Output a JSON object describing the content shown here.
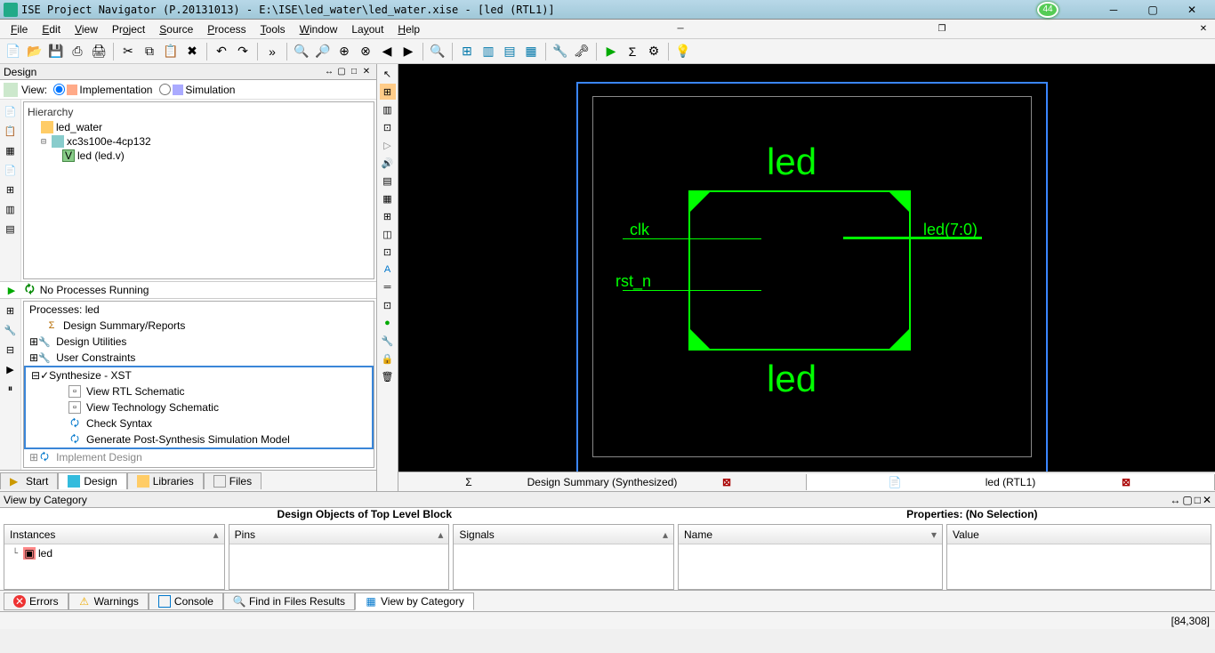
{
  "titlebar": {
    "title": "ISE Project Navigator (P.20131013) - E:\\ISE\\led_water\\led_water.xise - [led (RTL1)]",
    "badge": "44"
  },
  "menu": {
    "file": "File",
    "edit": "Edit",
    "view": "View",
    "project": "Project",
    "source": "Source",
    "process": "Process",
    "tools": "Tools",
    "window": "Window",
    "layout": "Layout",
    "help": "Help"
  },
  "design_panel": {
    "title": "Design",
    "view_label": "View:",
    "mode_impl": "Implementation",
    "mode_sim": "Simulation",
    "hierarchy_label": "Hierarchy",
    "tree": {
      "project": "led_water",
      "device": "xc3s100e-4cp132",
      "top_module": "led (led.v)"
    },
    "no_proc_running": "No Processes Running",
    "processes_label": "Processes: led",
    "processes": {
      "summary": "Design Summary/Reports",
      "utilities": "Design Utilities",
      "constraints": "User Constraints",
      "synth": "Synthesize - XST",
      "view_rtl": "View RTL Schematic",
      "view_tech": "View Technology Schematic",
      "check_syntax": "Check Syntax",
      "gen_post": "Generate Post-Synthesis Simulation Model",
      "implement": "Implement Design"
    }
  },
  "left_tabs": {
    "start": "Start",
    "design": "Design",
    "libraries": "Libraries",
    "files": "Files"
  },
  "schematic": {
    "top_label": "led",
    "bottom_label": "led",
    "port_clk": "clk",
    "port_rst": "rst_n",
    "port_out": "led(7:0)"
  },
  "schematic_tabs": {
    "summary": "Design Summary (Synthesized)",
    "rtl": "led (RTL1)"
  },
  "bottom": {
    "panel_title": "View by Category",
    "objects_title": "Design Objects of Top Level Block",
    "properties_title": "Properties: (No Selection)",
    "col_instances": "Instances",
    "col_pins": "Pins",
    "col_signals": "Signals",
    "col_name": "Name",
    "col_value": "Value",
    "instance_item": "led"
  },
  "bottom_tabs": {
    "errors": "Errors",
    "warnings": "Warnings",
    "console": "Console",
    "find": "Find in Files Results",
    "view_cat": "View by Category"
  },
  "status": {
    "coords": "[84,308]"
  }
}
